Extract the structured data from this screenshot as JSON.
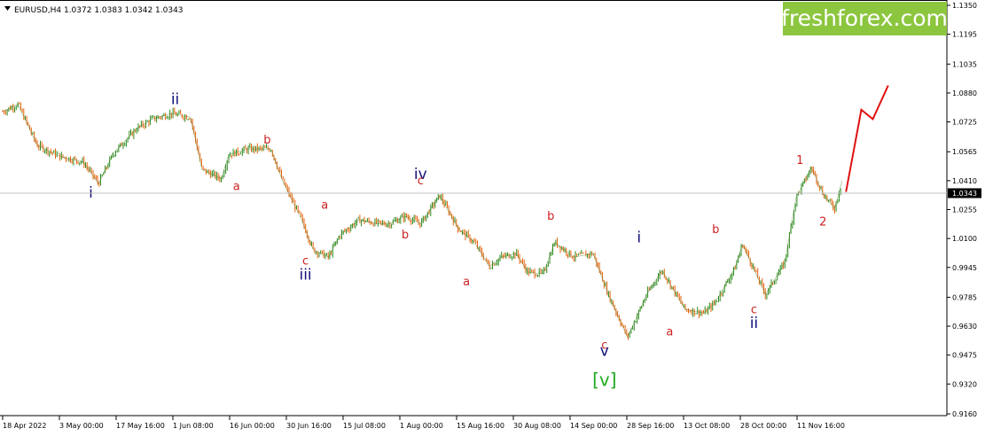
{
  "brand": {
    "text": "freshforex.com",
    "bg_color": "#8cc63f"
  },
  "header": {
    "symbol_icon": "dropdown-triangle-icon",
    "ohlc_text": "EURUSD,H4  1.0372 1.0383 1.0342 1.0343"
  },
  "colors": {
    "bull": "#2e8b1f",
    "bear": "#e8620a",
    "forecast": "#e01010",
    "wave_red": "#cc2222",
    "wave_navy": "#12127a",
    "wave_green": "#22aa22"
  },
  "chart_data": {
    "type": "line",
    "title": "EURUSD,H4",
    "ylim": [
      0.916,
      1.135
    ],
    "y_ticks": [
      "1.1350",
      "1.1195",
      "1.1035",
      "1.0880",
      "1.0725",
      "1.0565",
      "1.0410",
      "1.0255",
      "1.0100",
      "0.9945",
      "0.9785",
      "0.9630",
      "0.9475",
      "0.9320",
      "0.9160"
    ],
    "current_price": "1.0343",
    "x_labels": [
      "18 Apr 2022",
      "3 May 00:00",
      "17 May 16:00",
      "1 Jun 08:00",
      "16 Jun 00:00",
      "30 Jun 16:00",
      "15 Jul 08:00",
      "1 Aug 00:00",
      "15 Aug 16:00",
      "30 Aug 08:00",
      "14 Sep 00:00",
      "28 Sep 16:00",
      "13 Oct 08:00",
      "28 Oct 00:00",
      "11 Nov 16:00"
    ],
    "grid": false,
    "series": [
      {
        "kind": "price",
        "x": [
          "18 Apr",
          "22 Apr",
          "27 Apr",
          "3 May",
          "9 May",
          "13 May",
          "17 May",
          "23 May",
          "27 May",
          "1 Jun",
          "6 Jun",
          "9 Jun",
          "14 Jun",
          "16 Jun",
          "21 Jun",
          "27 Jun",
          "30 Jun",
          "5 Jul",
          "8 Jul",
          "12 Jul",
          "15 Jul",
          "20 Jul",
          "25 Jul",
          "28 Jul",
          "1 Aug",
          "5 Aug",
          "10 Aug",
          "15 Aug",
          "19 Aug",
          "23 Aug",
          "26 Aug",
          "30 Aug",
          "2 Sep",
          "6 Sep",
          "9 Sep",
          "14 Sep",
          "19 Sep",
          "23 Sep",
          "28 Sep",
          "3 Oct",
          "7 Oct",
          "13 Oct",
          "18 Oct",
          "21 Oct",
          "26 Oct",
          "28 Oct",
          "3 Nov",
          "8 Nov",
          "11 Nov",
          "15 Nov",
          "18 Nov",
          "21 Nov",
          "23 Nov"
        ],
        "y": [
          1.078,
          1.082,
          1.06,
          1.054,
          1.051,
          1.0395,
          1.056,
          1.069,
          1.074,
          1.077,
          1.075,
          1.047,
          1.042,
          1.055,
          1.058,
          1.058,
          1.041,
          1.02,
          1.004,
          1.0,
          1.012,
          1.02,
          1.018,
          1.018,
          1.022,
          1.018,
          1.033,
          1.015,
          1.008,
          0.995,
          1.0,
          1.002,
          0.992,
          0.991,
          1.008,
          1.0,
          1.002,
          0.98,
          0.957,
          0.98,
          0.993,
          0.972,
          0.97,
          0.976,
          0.994,
          1.007,
          0.98,
          0.997,
          1.032,
          1.048,
          1.034,
          1.026,
          1.041
        ]
      },
      {
        "kind": "forecast",
        "x": [
          "24 Nov",
          "28 Nov",
          "1 Dec",
          "5 Dec"
        ],
        "y": [
          1.035,
          1.079,
          1.074,
          1.092
        ]
      }
    ],
    "annotations": [
      {
        "text": "i",
        "x": "11 May",
        "y": 1.032,
        "style": "navy"
      },
      {
        "text": "ii",
        "x": "2 Jun",
        "y": 1.082,
        "style": "navy"
      },
      {
        "text": "iii",
        "x": "6 Jul",
        "y": 0.988,
        "style": "navy"
      },
      {
        "text": "iv",
        "x": "5 Aug",
        "y": 1.042,
        "style": "navy"
      },
      {
        "text": "v",
        "x": "22 Sep",
        "y": 0.947,
        "style": "navy"
      },
      {
        "text": "i",
        "x": "1 Oct",
        "y": 1.008,
        "style": "navy"
      },
      {
        "text": "ii",
        "x": "31 Oct",
        "y": 0.962,
        "style": "navy"
      },
      {
        "text": "[v]",
        "x": "22 Sep",
        "y": 0.931,
        "style": "green"
      },
      {
        "text": "a",
        "x": "18 Jun",
        "y": 1.036,
        "style": "red"
      },
      {
        "text": "b",
        "x": "26 Jun",
        "y": 1.061,
        "style": "red"
      },
      {
        "text": "a",
        "x": "11 Jul",
        "y": 1.026,
        "style": "red"
      },
      {
        "text": "c",
        "x": "6 Jul",
        "y": 0.996,
        "style": "red"
      },
      {
        "text": "b",
        "x": "1 Aug",
        "y": 1.01,
        "style": "red"
      },
      {
        "text": "c",
        "x": "5 Aug",
        "y": 1.039,
        "style": "red"
      },
      {
        "text": "a",
        "x": "17 Aug",
        "y": 0.985,
        "style": "red"
      },
      {
        "text": "b",
        "x": "8 Sep",
        "y": 1.02,
        "style": "red"
      },
      {
        "text": "c",
        "x": "22 Sep",
        "y": 0.951,
        "style": "red"
      },
      {
        "text": "a",
        "x": "9 Oct",
        "y": 0.958,
        "style": "red"
      },
      {
        "text": "b",
        "x": "21 Oct",
        "y": 1.013,
        "style": "red"
      },
      {
        "text": "c",
        "x": "31 Oct",
        "y": 0.97,
        "style": "red"
      },
      {
        "text": "1",
        "x": "12 Nov",
        "y": 1.05,
        "style": "red"
      },
      {
        "text": "2",
        "x": "18 Nov",
        "y": 1.017,
        "style": "red"
      }
    ]
  }
}
